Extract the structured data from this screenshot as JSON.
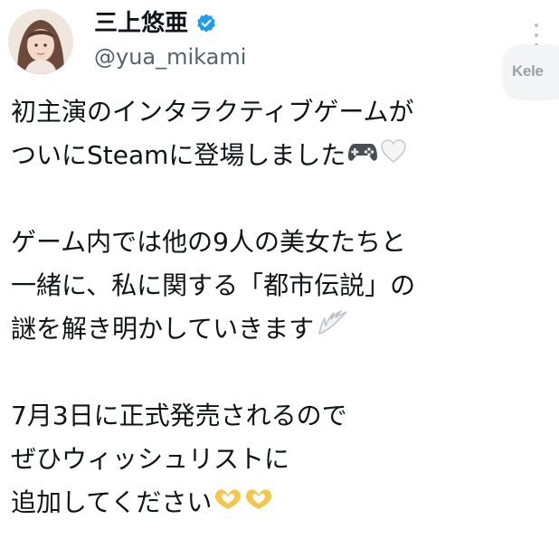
{
  "user": {
    "display_name": "三上悠亜",
    "handle": "@yua_mikami",
    "verified": true,
    "verified_color": "#1d9bf0"
  },
  "header": {
    "more_icon": "more-vertical-icon",
    "float_button_label": "Kele"
  },
  "post": {
    "paragraph1": {
      "line1": "初主演のインタラクティブゲームが",
      "line2": "ついにSteamに登場しました",
      "line2_icons": [
        "game-controller-icon",
        "white-heart-icon"
      ]
    },
    "paragraph2": {
      "line1": "ゲーム内では他の9人の美女たちと",
      "line2": "一緒に、私に関する「都市伝説」の",
      "line3": "謎を解き明かしていきます",
      "line3_icons": [
        "wing-icon"
      ]
    },
    "paragraph3": {
      "line1": "7月3日に正式発売されるので",
      "line2": "ぜひウィッシュリストに",
      "line3": "追加してください",
      "line3_icons": [
        "heart-hands-icon",
        "heart-hands-icon"
      ]
    }
  }
}
